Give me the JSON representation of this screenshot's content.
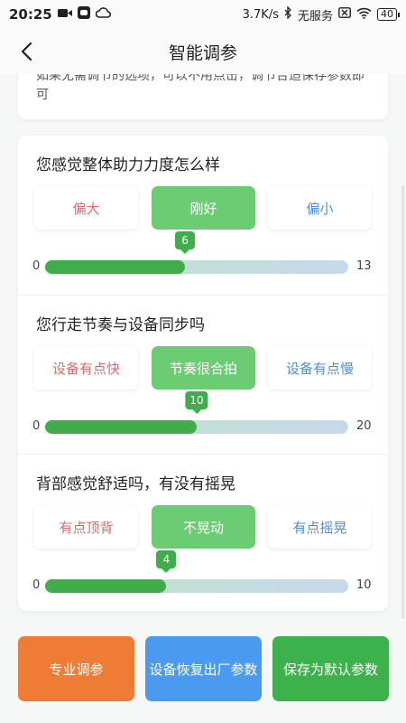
{
  "status_bar": {
    "time": "20:25",
    "network_speed": "3.7K/s",
    "carrier": "无服务",
    "battery": "40"
  },
  "header": {
    "title": "智能调参"
  },
  "tip": {
    "text": "如果无需调节的选项，可以不用点击，调节合适保存参数即可"
  },
  "questions": [
    {
      "title": "您感觉整体助力力度怎么样",
      "options": [
        "偏大",
        "刚好",
        "偏小"
      ],
      "selected_index": 1,
      "value": 6,
      "min": 0,
      "max": 13,
      "value_label": "6",
      "min_label": "0",
      "max_label": "13"
    },
    {
      "title": "您行走节奏与设备同步吗",
      "options": [
        "设备有点快",
        "节奏很合拍",
        "设备有点慢"
      ],
      "selected_index": 1,
      "value": 10,
      "min": 0,
      "max": 20,
      "value_label": "10",
      "min_label": "0",
      "max_label": "20"
    },
    {
      "title": "背部感觉舒适吗，有没有摇晃",
      "options": [
        "有点顶背",
        "不晃动",
        "有点摇晃"
      ],
      "selected_index": 1,
      "value": 4,
      "min": 0,
      "max": 10,
      "value_label": "4",
      "min_label": "0",
      "max_label": "10"
    }
  ],
  "footer": {
    "professional_label": "专业调参",
    "factory_reset_label": "设备恢复出厂参数",
    "save_default_label": "保存为默认参数"
  },
  "colors": {
    "selected_green": "#6ccc74",
    "slider_green": "#3fae4a",
    "orange": "#ef7c34",
    "blue": "#4a9af0",
    "green": "#3db14c"
  }
}
